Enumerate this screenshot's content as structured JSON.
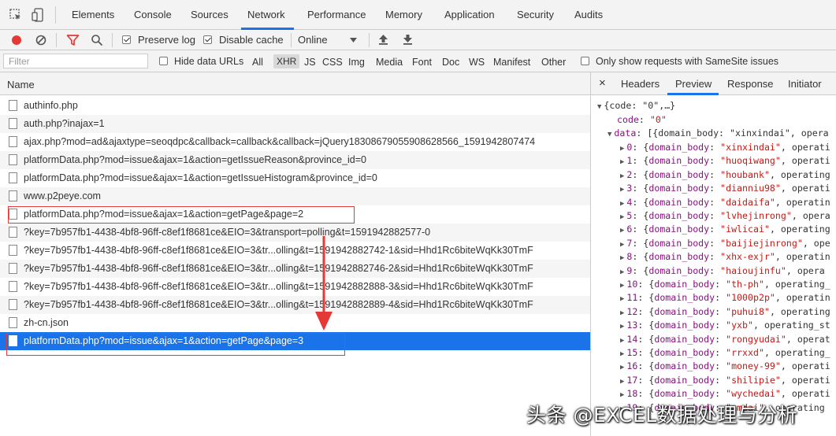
{
  "tabs": [
    "Elements",
    "Console",
    "Sources",
    "Network",
    "Performance",
    "Memory",
    "Application",
    "Security",
    "Audits"
  ],
  "active_tab": "Network",
  "toolbar": {
    "preserve_log_label": "Preserve log",
    "disable_cache_label": "Disable cache",
    "throttling_value": "Online"
  },
  "filterbar": {
    "placeholder": "Filter",
    "hide_data_urls_label": "Hide data URLs",
    "types": [
      "All",
      "XHR",
      "JS",
      "CSS",
      "Img",
      "Media",
      "Font",
      "Doc",
      "WS",
      "Manifest",
      "Other"
    ],
    "active_type": "XHR",
    "samesite_label": "Only show requests with SameSite issues"
  },
  "list": {
    "header_name": "Name",
    "rows": [
      "authinfo.php",
      "auth.php?inajax=1",
      "ajax.php?mod=ad&ajaxtype=seoqdpc&callback=callback&callback=jQuery18308679055908628566_1591942807474",
      "platformData.php?mod=issue&ajax=1&action=getIssueReason&province_id=0",
      "platformData.php?mod=issue&ajax=1&action=getIssueHistogram&province_id=0",
      "www.p2peye.com",
      "platformData.php?mod=issue&ajax=1&action=getPage&page=2",
      "?key=7b957fb1-4438-4bf8-96ff-c8ef1f8681ce&EIO=3&transport=polling&t=1591942882577-0",
      "?key=7b957fb1-4438-4bf8-96ff-c8ef1f8681ce&EIO=3&tr...olling&t=1591942882742-1&sid=Hhd1Rc6biteWqKk30TmF",
      "?key=7b957fb1-4438-4bf8-96ff-c8ef1f8681ce&EIO=3&tr...olling&t=1591942882746-2&sid=Hhd1Rc6biteWqKk30TmF",
      "?key=7b957fb1-4438-4bf8-96ff-c8ef1f8681ce&EIO=3&tr...olling&t=1591942882888-3&sid=Hhd1Rc6biteWqKk30TmF",
      "?key=7b957fb1-4438-4bf8-96ff-c8ef1f8681ce&EIO=3&tr...olling&t=1591942882889-4&sid=Hhd1Rc6biteWqKk30TmF",
      "zh-cn.json",
      "platformData.php?mod=issue&ajax=1&action=getPage&page=3"
    ],
    "selected_index": 13
  },
  "preview": {
    "close_symbol": "×",
    "tabs": [
      "Headers",
      "Preview",
      "Response",
      "Initiator"
    ],
    "active_tab": "Preview",
    "root_line": "{code: \"0\",…}",
    "code_key": "code",
    "code_value": "\"0\"",
    "data_key": "data",
    "data_summary": "[{domain_body: \"xinxindai\", opera",
    "items": [
      {
        "idx": "0",
        "domain": "\"xinxindai\"",
        "tail": ", operati"
      },
      {
        "idx": "1",
        "domain": "\"huoqiwang\"",
        "tail": ", operati"
      },
      {
        "idx": "2",
        "domain": "\"houbank\"",
        "tail": ", operating"
      },
      {
        "idx": "3",
        "domain": "\"dianniu98\"",
        "tail": ", operati"
      },
      {
        "idx": "4",
        "domain": "\"daidaifa\"",
        "tail": ", operatin"
      },
      {
        "idx": "5",
        "domain": "\"lvhejinrong\"",
        "tail": ", opera"
      },
      {
        "idx": "6",
        "domain": "\"iwlicai\"",
        "tail": ", operating"
      },
      {
        "idx": "7",
        "domain": "\"baijiejinrong\"",
        "tail": ", ope"
      },
      {
        "idx": "8",
        "domain": "\"xhx-exjr\"",
        "tail": ", operatin"
      },
      {
        "idx": "9",
        "domain": "\"haioujinfu\"",
        "tail": ", opera"
      },
      {
        "idx": "10",
        "domain": "\"th-ph\"",
        "tail": ", operating_"
      },
      {
        "idx": "11",
        "domain": "\"1000p2p\"",
        "tail": ", operatin"
      },
      {
        "idx": "12",
        "domain": "\"puhui8\"",
        "tail": ", operating"
      },
      {
        "idx": "13",
        "domain": "\"yxb\"",
        "tail": ", operating_st"
      },
      {
        "idx": "14",
        "domain": "\"rongyudai\"",
        "tail": ", operat"
      },
      {
        "idx": "15",
        "domain": "\"rrxxd\"",
        "tail": ", operating_"
      },
      {
        "idx": "16",
        "domain": "\"money-99\"",
        "tail": ", operati"
      },
      {
        "idx": "17",
        "domain": "\"shilipie\"",
        "tail": ", operati"
      },
      {
        "idx": "18",
        "domain": "\"wychedai\"",
        "tail": ", operati"
      },
      {
        "idx": "19",
        "domain": "\"zmdai\"",
        "tail": ", operating"
      }
    ]
  },
  "watermark": "头条 @EXCEL数据处理与分析",
  "colors": {
    "accent": "#1a73e8",
    "record_red": "#e53935",
    "annotation_red": "#e03a3a"
  }
}
